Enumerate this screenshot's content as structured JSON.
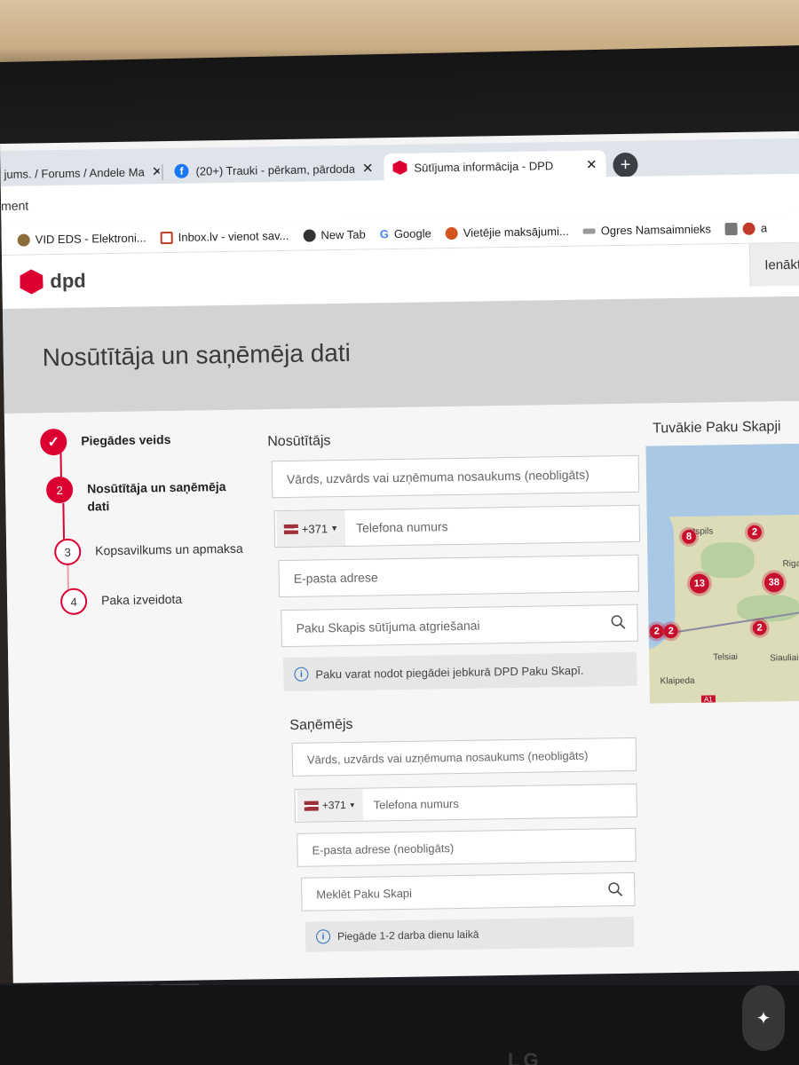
{
  "browser": {
    "tabs": [
      {
        "label": "jums. / Forums / Andele Ma"
      },
      {
        "label": "(20+) Trauki - pērkam, pārdodam"
      },
      {
        "label": "Sūtījuma informācija - DPD"
      }
    ],
    "address_partial": "ment",
    "bookmarks": [
      {
        "label": "VID EDS - Elektroni..."
      },
      {
        "label": "Inbox.lv - vienot sav..."
      },
      {
        "label": "New Tab"
      },
      {
        "label": "Google"
      },
      {
        "label": "Vietējie maksājumi..."
      },
      {
        "label": "Ogres Namsaimnieks"
      },
      {
        "label": "a"
      }
    ]
  },
  "header": {
    "logo_text": "dpd",
    "login_label": "Ienākt"
  },
  "page": {
    "title": "Nosūtītāja un saņēmēja dati"
  },
  "steps": [
    {
      "number": "",
      "label": "Piegādes veids",
      "state": "done"
    },
    {
      "number": "2",
      "label": "Nosūtītāja un saņēmēja dati",
      "state": "current"
    },
    {
      "number": "3",
      "label": "Kopsavilkums un apmaksa",
      "state": "todo"
    },
    {
      "number": "4",
      "label": "Paka izveidota",
      "state": "todo"
    }
  ],
  "sender": {
    "title": "Nosūtītājs",
    "name_placeholder": "Vārds, uzvārds vai uzņēmuma nosaukums (neobligāts)",
    "phone_prefix": "+371",
    "phone_placeholder": "Telefona numurs",
    "email_placeholder": "E-pasta adrese",
    "locker_placeholder": "Paku Skapis sūtījuma atgriešanai",
    "info": "Paku varat nodot piegādei jebkurā DPD Paku Skapī."
  },
  "receiver": {
    "title": "Saņēmējs",
    "name_placeholder": "Vārds, uzvārds vai uzņēmuma nosaukums (neobligāts)",
    "phone_prefix": "+371",
    "phone_placeholder": "Telefona numurs",
    "email_placeholder": "E-pasta adrese (neobligāts)",
    "locker_placeholder": "Meklēt Paku Skapi",
    "info": "Piegāde 1-2 darba dienu laikā"
  },
  "map": {
    "title": "Tuvākie Paku Skapji",
    "clusters": [
      "8",
      "2",
      "13",
      "38",
      "2",
      "2",
      "2"
    ],
    "places": [
      "ntspils",
      "Riga",
      "Telsiai",
      "Siauliai",
      "Klaipeda",
      "A1"
    ]
  },
  "colors": {
    "accent": "#dc0032"
  }
}
